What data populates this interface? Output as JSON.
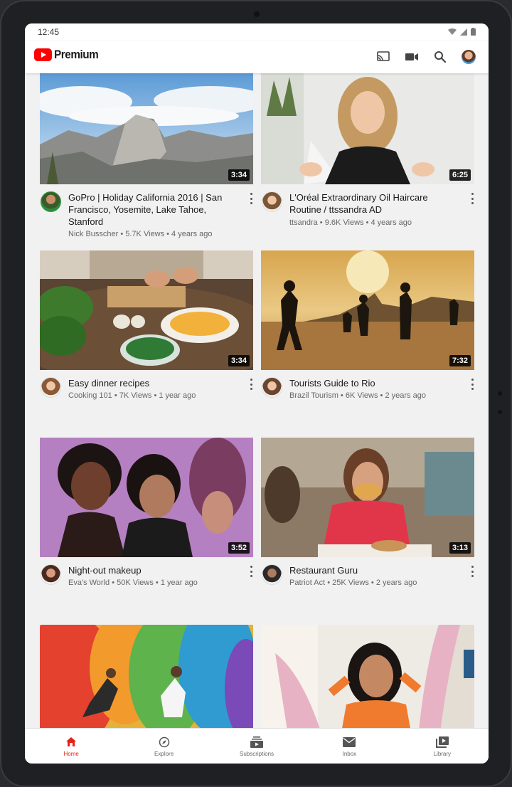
{
  "status": {
    "time": "12:45"
  },
  "app": {
    "logo_text": "Premium"
  },
  "colors": {
    "brand_red": "#ff0000",
    "active_nav": "#e62117"
  },
  "appbar": {
    "icons": [
      "cast-icon",
      "camera-icon",
      "search-icon",
      "account-avatar"
    ]
  },
  "videos": [
    {
      "title": "GoPro | Holiday California 2016 | San Francisco, Yosemite, Lake Tahoe, Stanford",
      "byline": "Nick Busscher • 5.7K Views • 4 years ago",
      "duration": "3:34"
    },
    {
      "title": "L'Oréal Extraordinary Oil Haircare Routine / ttssandra AD",
      "byline": "ttsandra • 9.6K Views • 4 years ago",
      "duration": "6:25"
    },
    {
      "title": "Easy dinner recipes",
      "byline": "Cooking 101 • 7K Views • 1 year ago",
      "duration": "3:34"
    },
    {
      "title": "Tourists Guide to Rio",
      "byline": "Brazil Tourism • 6K Views • 2 years ago",
      "duration": "7:32"
    },
    {
      "title": "Night-out makeup",
      "byline": "Eva's World • 50K Views • 1 year ago",
      "duration": "3:52"
    },
    {
      "title": "Restaurant Guru",
      "byline": "Patriot Act • 25K Views • 2 years ago",
      "duration": "3:13"
    }
  ],
  "nav": [
    {
      "label": "Home",
      "icon": "home-icon"
    },
    {
      "label": "Explore",
      "icon": "compass-icon"
    },
    {
      "label": "Subscriptions",
      "icon": "subscriptions-icon"
    },
    {
      "label": "Inbox",
      "icon": "mail-icon"
    },
    {
      "label": "Library",
      "icon": "library-icon"
    }
  ]
}
